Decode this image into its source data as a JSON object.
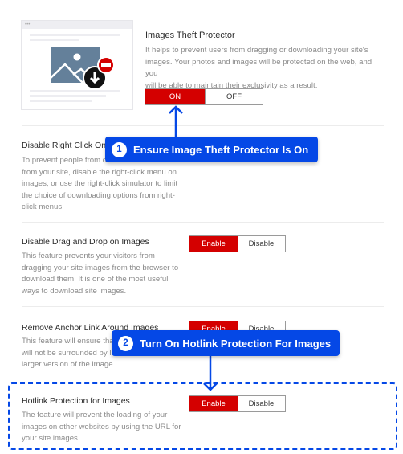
{
  "theft_protector": {
    "title": "Images Theft Protector",
    "desc_lines": [
      "It helps to prevent users from dragging or downloading your site's",
      "images. Your photos and images will be protected on the web, and you",
      "will be able to maintain their exclusivity as a result."
    ],
    "on_label": "ON",
    "off_label": "OFF",
    "state": "ON"
  },
  "sections": [
    {
      "title": "Disable Right Click On Im",
      "desc_lines": [
        "To prevent people from d",
        "from your site, disable the right-click menu on",
        "images, or use the right-click simulator to limit",
        "the choice of downloading options from right-",
        "click menus."
      ]
    },
    {
      "title": "Disable Drag and Drop on Images",
      "desc_lines": [
        "This feature prevents your visitors from",
        "dragging your site images from the browser to",
        "download them. It is one of the most useful",
        "ways to download site images."
      ],
      "enable_label": "Enable",
      "disable_label": "Disable",
      "state": "Enable"
    },
    {
      "title": "Remove Anchor Link Around Images",
      "desc_lines": [
        "This feature will ensure that",
        "will not be surrounded by li",
        "larger version of the image."
      ],
      "enable_label": "Enable",
      "disable_label": "Disable",
      "state": "Enable"
    },
    {
      "title": "Hotlink Protection for Images",
      "desc_lines": [
        "The feature will prevent the loading of your",
        "images on other websites by using the URL for",
        "your site images."
      ],
      "enable_label": "Enable",
      "disable_label": "Disable",
      "state": "Enable"
    }
  ],
  "callouts": [
    {
      "number": "1",
      "text": "Ensure Image Theft Protector Is On"
    },
    {
      "number": "2",
      "text": "Turn On Hotlink Protection For Images"
    }
  ],
  "colors": {
    "accent": "#0548e6",
    "active": "#d40000"
  }
}
